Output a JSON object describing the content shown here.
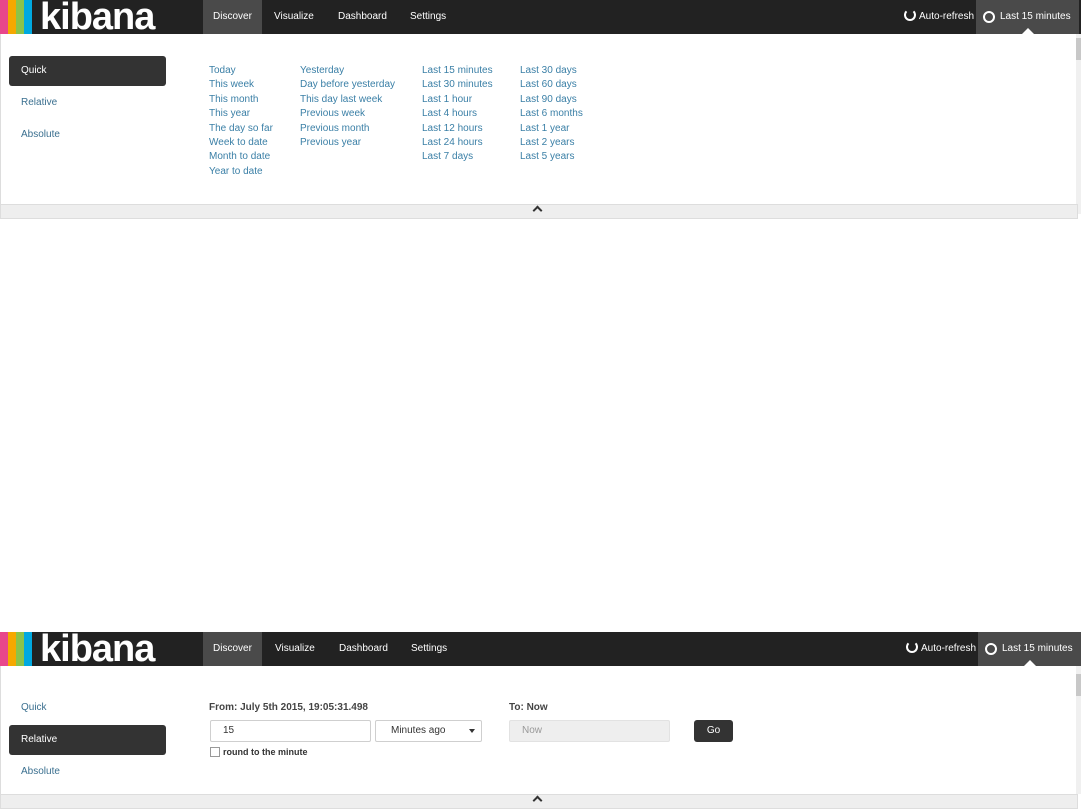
{
  "brand": {
    "name": "kibana",
    "stripe_colors": [
      "#e8478b",
      "#f5a800",
      "#8bc34a",
      "#00a9e0"
    ]
  },
  "nav": {
    "items": [
      {
        "label": "Discover"
      },
      {
        "label": "Visualize"
      },
      {
        "label": "Dashboard"
      },
      {
        "label": "Settings"
      }
    ],
    "auto_refresh": "Auto-refresh",
    "timepicker": "Last 15 minutes"
  },
  "tabs": {
    "quick": "Quick",
    "relative": "Relative",
    "absolute": "Absolute"
  },
  "quick": {
    "col1": [
      "Today",
      "This week",
      "This month",
      "This year",
      "The day so far",
      "Week to date",
      "Month to date",
      "Year to date"
    ],
    "col2": [
      "Yesterday",
      "Day before yesterday",
      "This day last week",
      "Previous week",
      "Previous month",
      "Previous year"
    ],
    "col3": [
      "Last 15 minutes",
      "Last 30 minutes",
      "Last 1 hour",
      "Last 4 hours",
      "Last 12 hours",
      "Last 24 hours",
      "Last 7 days"
    ],
    "col4": [
      "Last 30 days",
      "Last 60 days",
      "Last 90 days",
      "Last 6 months",
      "Last 1 year",
      "Last 2 years",
      "Last 5 years"
    ]
  },
  "relative": {
    "from_label": "From: July 5th 2015, 19:05:31.498",
    "from_value": "15",
    "unit_selected": "Minutes ago",
    "round_label": "round to the minute",
    "round_checked": false,
    "to_label": "To: Now",
    "to_value": "Now",
    "go_label": "Go"
  }
}
